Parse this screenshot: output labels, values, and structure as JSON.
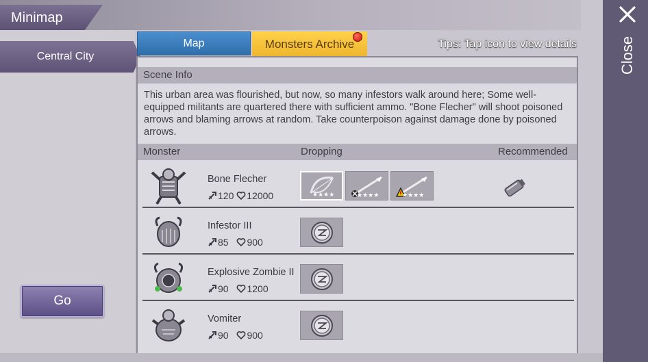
{
  "header": {
    "title": "Minimap"
  },
  "sidebar": {
    "city_label": "Central City",
    "go_label": "Go"
  },
  "tabs": [
    {
      "label": "Map",
      "active": false
    },
    {
      "label": "Monsters Archive",
      "active": true,
      "notification": true
    }
  ],
  "tips": "Tips: Tap icon to view details",
  "scene": {
    "heading": "Scene Info",
    "description": "This urban area was flourished, but now, so many infestors walk around here; Some well-equipped militants are quartered there with sufficient ammo. \"Bone Flecher\" will shoot poisoned arrows and blaming arrows at random. Take counterpoison against damage done by poisoned arrows."
  },
  "columns": {
    "monster": "Monster",
    "dropping": "Dropping",
    "recommended": "Recommended"
  },
  "monsters": [
    {
      "name": "Bone Flecher",
      "attack": "120",
      "hp": "12000",
      "drops": [
        "bow-icon",
        "poison-arrow-icon",
        "fire-arrow-icon"
      ],
      "recommended": "counterpoison-vial-icon"
    },
    {
      "name": "Infestor III",
      "attack": "85",
      "hp": "900",
      "drops": [
        "coin-icon"
      ]
    },
    {
      "name": "Explosive Zombie II",
      "attack": "90",
      "hp": "1200",
      "drops": [
        "coin-icon"
      ]
    },
    {
      "name": "Vomiter",
      "attack": "90",
      "hp": "900",
      "drops": [
        "coin-icon"
      ]
    }
  ],
  "close_label": "Close",
  "colors": {
    "tab_map": "#3a7fc0",
    "tab_active": "#f5bf33",
    "panel": "#605a75",
    "go_button": "#6f63a0"
  }
}
